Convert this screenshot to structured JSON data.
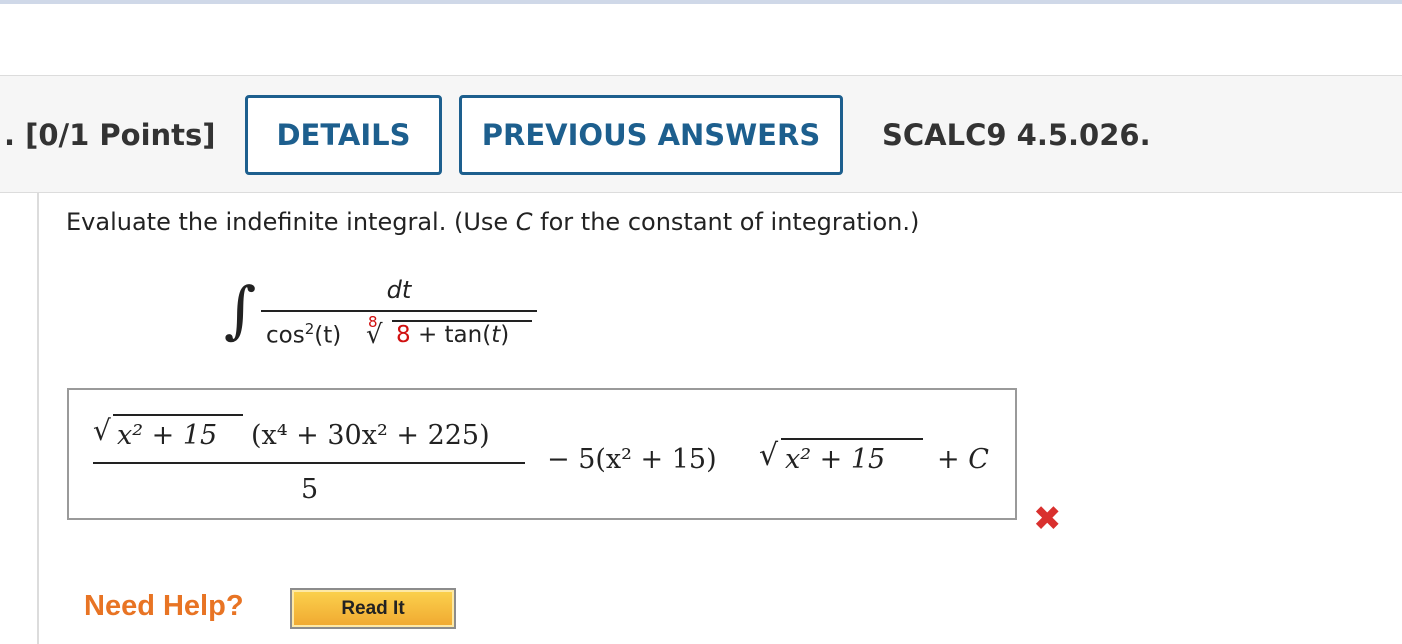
{
  "header": {
    "points": ". [0/1 Points]",
    "details_label": "DETAILS",
    "previous_answers_label": "PREVIOUS ANSWERS",
    "reference": "SCALC9 4.5.026."
  },
  "question": {
    "text_before": "Evaluate the indefinite integral. (Use ",
    "constant": "C",
    "text_after": " for the constant of integration.)",
    "integral": {
      "numerator": "dt",
      "denominator_prefix": "cos",
      "denominator_power": "2",
      "denominator_arg": "(t)",
      "root_index": "8",
      "radicand_highlight": "8",
      "radicand_rest": "+ tan(",
      "radicand_var": "t",
      "radicand_close": ")"
    }
  },
  "answer": {
    "status": "incorrect",
    "numerator": {
      "sqrt_inner": "x² + 15",
      "poly": "(x⁴ + 30x² + 225)"
    },
    "denominator": "5",
    "second_term": "− 5(x² + 15)",
    "second_sqrt_inner": "x² + 15",
    "constant": "+ C"
  },
  "help": {
    "need_help_label": "Need Help?",
    "read_it_label": "Read It"
  },
  "colors": {
    "button_border": "#1d5f8e",
    "red_highlight": "#d01010",
    "wrong_mark": "#d9302e",
    "need_help": "#e87424"
  }
}
